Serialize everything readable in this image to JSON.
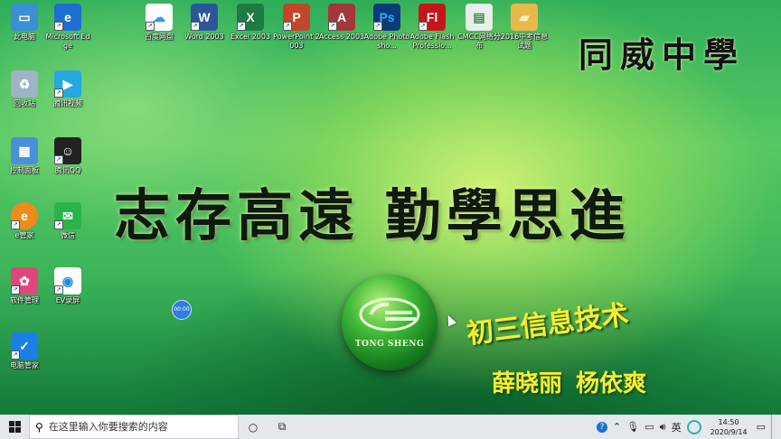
{
  "desktop_icons": [
    {
      "id": "this-pc",
      "label": "此电脑",
      "glyph": "▭",
      "color": "#3a8fd6",
      "shortcut": false
    },
    {
      "id": "edge",
      "label": "Microsoft Edge",
      "glyph": "e",
      "color": "#1e6fd0",
      "shortcut": true
    },
    {
      "id": "baidu-netdisk",
      "label": "百度网盘",
      "glyph": "☁",
      "color": "#2a9df4",
      "shortcut": true
    },
    {
      "id": "word",
      "label": "Word 2003",
      "glyph": "W",
      "color": "#2b579a",
      "shortcut": true
    },
    {
      "id": "excel",
      "label": "Excel 2003",
      "glyph": "X",
      "color": "#1f7a43",
      "shortcut": true
    },
    {
      "id": "powerpoint",
      "label": "PowerPoint 2003",
      "glyph": "P",
      "color": "#c4462a",
      "shortcut": true
    },
    {
      "id": "access",
      "label": "Access 2003",
      "glyph": "A",
      "color": "#a4373a",
      "shortcut": true
    },
    {
      "id": "photoshop",
      "label": "Adobe Photosho...",
      "glyph": "Ps",
      "color": "#0b3b78",
      "shortcut": true
    },
    {
      "id": "flash",
      "label": "Adobe Flash Professio...",
      "glyph": "Fl",
      "color": "#c4161c",
      "shortcut": true
    },
    {
      "id": "cmcc",
      "label": "CMCC网络分布",
      "glyph": "▤",
      "color": "#e8efe8",
      "shortcut": false
    },
    {
      "id": "folder-2016",
      "label": "2016中考信息试题",
      "glyph": "▰",
      "color": "#e8b84a",
      "shortcut": false
    },
    {
      "id": "recycle-bin",
      "label": "回收站",
      "glyph": "♻",
      "color": "#9fb4c4",
      "shortcut": false
    },
    {
      "id": "tencent-video",
      "label": "腾讯视频",
      "glyph": "▶",
      "color": "#26a7e0",
      "shortcut": true
    },
    {
      "id": "control-panel",
      "label": "控制面板",
      "glyph": "▦",
      "color": "#4a90d9",
      "shortcut": false
    },
    {
      "id": "qq",
      "label": "腾讯QQ",
      "glyph": "☺",
      "color": "#222222",
      "shortcut": true
    },
    {
      "id": "e-manager",
      "label": "e管家",
      "glyph": "e",
      "color": "#f08a1c",
      "shortcut": true
    },
    {
      "id": "wechat",
      "label": "微信",
      "glyph": "✉",
      "color": "#29b34a",
      "shortcut": true
    },
    {
      "id": "software-manager",
      "label": "软件管理",
      "glyph": "✿",
      "color": "#e0457b",
      "shortcut": true
    },
    {
      "id": "ev-recorder",
      "label": "EV录屏",
      "glyph": "◉",
      "color": "#1d8be0",
      "shortcut": true
    },
    {
      "id": "pc-manager",
      "label": "电脑管家",
      "glyph": "✓",
      "color": "#1b7fe8",
      "shortcut": true
    }
  ],
  "wallpaper": {
    "school_name": "同威中學",
    "motto": "志存高遠 勤學思進",
    "logo_text": "TONG SHENG",
    "subject": "初三信息技术",
    "teachers": "薛晓丽 杨依爽"
  },
  "time_badge": "00:00",
  "taskbar": {
    "search_placeholder": "在这里输入你要搜索的内容",
    "tray": {
      "input_method": "英",
      "time": "14:50",
      "date": "2020/9/14"
    }
  }
}
